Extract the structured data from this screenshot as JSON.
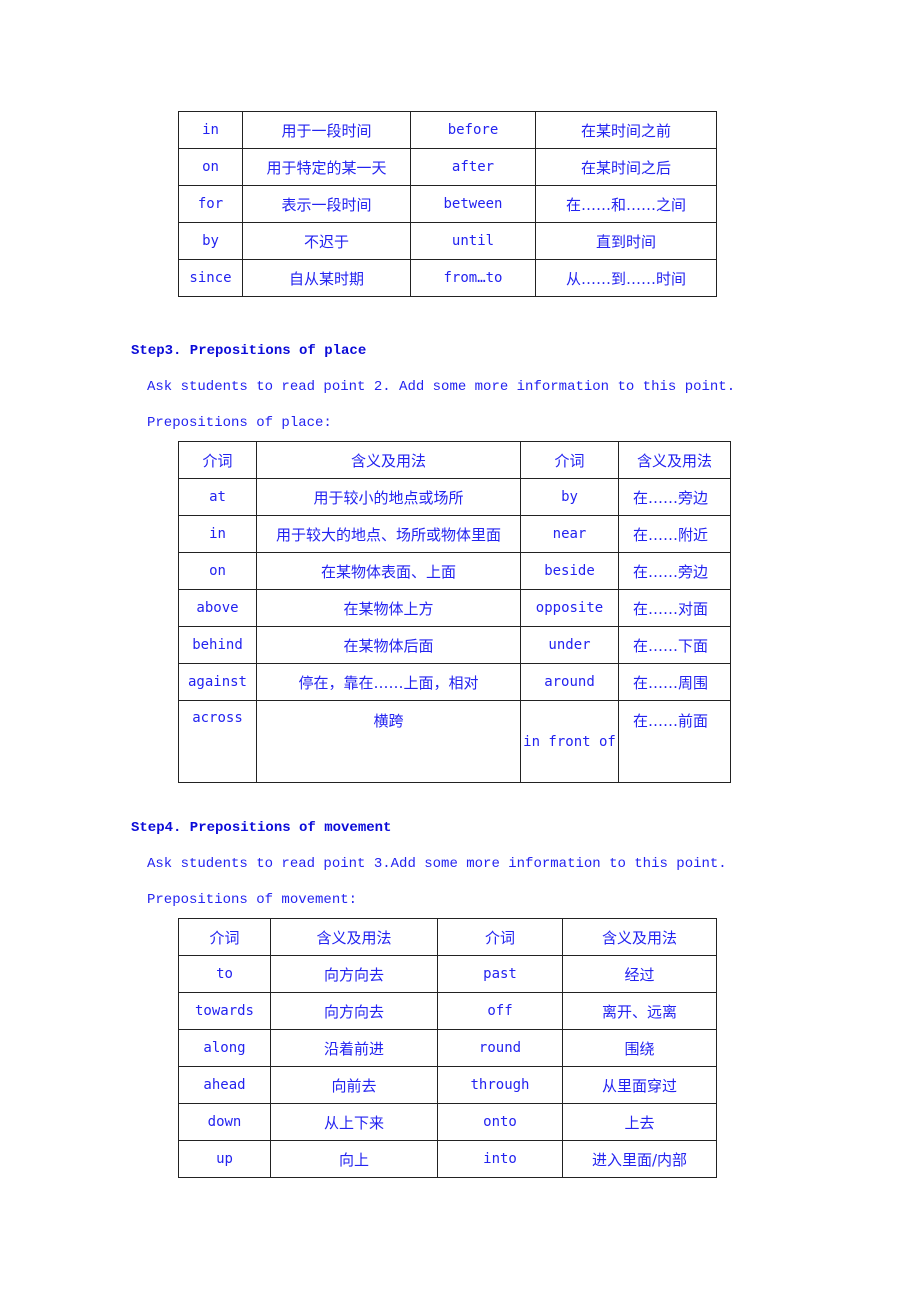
{
  "time_table": {
    "rows": [
      [
        "in",
        "用于一段时间",
        "before",
        "在某时间之前"
      ],
      [
        "on",
        "用于特定的某一天",
        "after",
        "在某时间之后"
      ],
      [
        "for",
        "表示一段时间",
        "between",
        "在……和……之间"
      ],
      [
        "by",
        "不迟于",
        "until",
        "直到时间"
      ],
      [
        "since",
        "自从某时期",
        "from…to",
        "从……到……时间"
      ]
    ]
  },
  "step3": {
    "heading": "Step3. Prepositions of place",
    "instruction": "Ask students to read point 2. Add some more information to this point.",
    "label": "Prepositions of place:",
    "headers": [
      "介词",
      "含义及用法",
      "介词",
      "含义及用法"
    ],
    "rows": [
      [
        "at",
        "用于较小的地点或场所",
        "by",
        "在……旁边"
      ],
      [
        "in",
        "用于较大的地点、场所或物体里面",
        "near",
        "在……附近"
      ],
      [
        "on",
        "在某物体表面、上面",
        "beside",
        "在……旁边"
      ],
      [
        "above",
        "在某物体上方",
        "opposite",
        "在……对面"
      ],
      [
        "behind",
        "在某物体后面",
        "under",
        "在……下面"
      ],
      [
        "against",
        "停在，靠在……上面，相对",
        "around",
        "在……周围"
      ],
      [
        "across",
        "横跨",
        "in front of",
        "在……前面"
      ]
    ]
  },
  "step4": {
    "heading": "Step4. Prepositions of movement",
    "instruction": "Ask students to read point 3.Add some more information to this point.",
    "label": "Prepositions of movement:",
    "headers": [
      "介词",
      "含义及用法",
      "介词",
      "含义及用法"
    ],
    "rows": [
      [
        "to",
        "向方向去",
        "past",
        "经过"
      ],
      [
        "towards",
        "向方向去",
        "off",
        "离开、远离"
      ],
      [
        "along",
        "沿着前进",
        "round",
        "围绕"
      ],
      [
        "ahead",
        "向前去",
        "through",
        "从里面穿过"
      ],
      [
        "down",
        "从上下来",
        "onto",
        "上去"
      ],
      [
        "up",
        "向上",
        "into",
        "进入里面/内部"
      ]
    ]
  }
}
